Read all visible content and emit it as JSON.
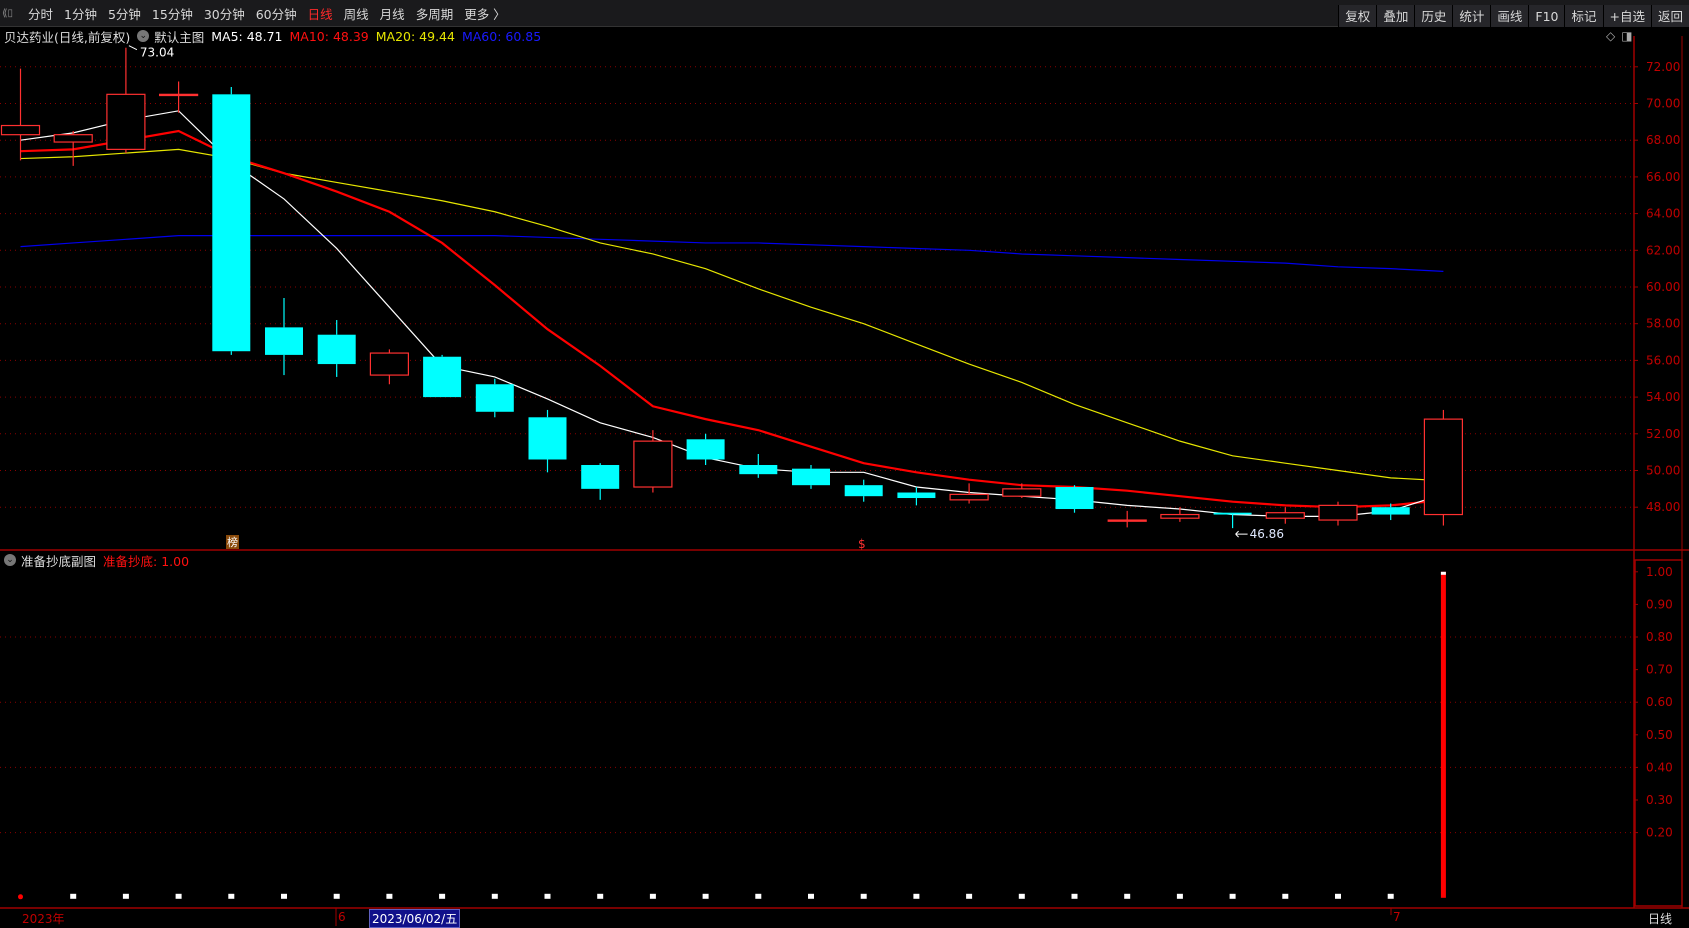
{
  "toolbar": {
    "periods": [
      "分时",
      "1分钟",
      "5分钟",
      "15分钟",
      "30分钟",
      "60分钟",
      "日线",
      "周线",
      "月线",
      "多周期",
      "更多 〉"
    ],
    "active_period": "日线",
    "actions": [
      "复权",
      "叠加",
      "历史",
      "统计",
      "画线",
      "F10",
      "标记",
      "+自选",
      "返回"
    ]
  },
  "main_header": {
    "stock": "贝达药业(日线,前复权)",
    "chart_name": "默认主图",
    "ma5": "MA5: 48.71",
    "ma10": "MA10: 48.39",
    "ma20": "MA20: 49.44",
    "ma60": "MA60: 60.85"
  },
  "sub_header": {
    "name": "准备抄底副图",
    "value": "准备抄底: 1.00"
  },
  "annotations": {
    "high_label": "73.04",
    "low_label": "46.86",
    "marker_bang": "榜",
    "marker_dollar": "$"
  },
  "datebar": {
    "year": "2023年",
    "month6": "6",
    "cursor_date": "2023/06/02/五",
    "month7": "7",
    "period_label": "日线"
  },
  "colors": {
    "up": "#ff3030",
    "down": "#00ffff",
    "ma5": "#ffffff",
    "ma10": "#ff0000",
    "ma20": "#e6e600",
    "ma60": "#0000ee",
    "axis": "#a00000"
  },
  "chart_data": {
    "type": "candlestick",
    "price_axis": {
      "min": 48,
      "max": 72,
      "step": 2,
      "ticks": [
        "72.00",
        "70.00",
        "68.00",
        "66.00",
        "64.00",
        "62.00",
        "60.00",
        "58.00",
        "56.00",
        "54.00",
        "52.00",
        "50.00",
        "48.00"
      ]
    },
    "candles": [
      [
        68.3,
        71.9,
        66.9,
        68.8
      ],
      [
        67.9,
        68.5,
        66.6,
        68.3
      ],
      [
        67.5,
        73.04,
        67.3,
        70.5
      ],
      [
        70.5,
        71.2,
        69.5,
        70.5
      ],
      [
        70.5,
        70.9,
        56.3,
        56.5
      ],
      [
        57.8,
        59.4,
        55.2,
        56.3
      ],
      [
        57.4,
        58.2,
        55.1,
        55.8
      ],
      [
        55.2,
        56.6,
        54.7,
        56.4
      ],
      [
        56.2,
        56.3,
        54.0,
        54.0
      ],
      [
        54.7,
        55.0,
        52.9,
        53.2
      ],
      [
        52.9,
        53.3,
        49.9,
        50.6
      ],
      [
        50.3,
        50.4,
        48.4,
        49.0
      ],
      [
        49.1,
        52.2,
        48.8,
        51.6
      ],
      [
        51.7,
        52.0,
        50.3,
        50.6
      ],
      [
        50.3,
        50.9,
        49.6,
        49.8
      ],
      [
        50.1,
        50.3,
        49.0,
        49.2
      ],
      [
        49.2,
        49.5,
        48.3,
        48.6
      ],
      [
        48.8,
        49.1,
        48.1,
        48.5
      ],
      [
        48.4,
        49.3,
        48.2,
        48.7
      ],
      [
        48.6,
        49.3,
        48.5,
        49.0
      ],
      [
        49.1,
        49.2,
        47.7,
        47.9
      ],
      [
        47.3,
        47.8,
        46.9,
        47.3
      ],
      [
        47.4,
        48.0,
        47.2,
        47.6
      ],
      [
        47.7,
        47.7,
        46.86,
        47.6
      ],
      [
        47.4,
        48.0,
        47.1,
        47.7
      ],
      [
        47.3,
        48.3,
        47.0,
        48.1
      ],
      [
        48.0,
        48.2,
        47.3,
        47.6
      ],
      [
        47.6,
        53.3,
        47.0,
        52.8
      ]
    ],
    "ma5": [
      68.0,
      68.4,
      69.1,
      69.6,
      66.8,
      64.8,
      62.1,
      58.9,
      55.7,
      55.1,
      53.9,
      52.6,
      51.8,
      50.7,
      50.1,
      49.9,
      49.9,
      49.1,
      48.8,
      48.6,
      48.4,
      48.1,
      47.9,
      47.6,
      47.5,
      47.5,
      47.8,
      48.71
    ],
    "ma10": [
      67.4,
      67.5,
      68.0,
      68.5,
      67.1,
      66.2,
      65.2,
      64.1,
      62.4,
      60.1,
      57.7,
      55.7,
      53.5,
      52.8,
      52.2,
      51.3,
      50.4,
      49.9,
      49.5,
      49.2,
      49.1,
      48.9,
      48.6,
      48.3,
      48.1,
      48.0,
      48.1,
      48.39
    ],
    "ma20": [
      67.0,
      67.1,
      67.3,
      67.5,
      67.0,
      66.2,
      65.7,
      65.2,
      64.7,
      64.1,
      63.3,
      62.4,
      61.8,
      61.0,
      59.9,
      58.9,
      58.0,
      56.9,
      55.8,
      54.8,
      53.6,
      52.6,
      51.6,
      50.8,
      50.4,
      50.0,
      49.6,
      49.44
    ],
    "ma60": [
      62.2,
      62.4,
      62.6,
      62.8,
      62.8,
      62.8,
      62.8,
      62.8,
      62.8,
      62.8,
      62.7,
      62.6,
      62.5,
      62.4,
      62.4,
      62.3,
      62.2,
      62.1,
      62.0,
      61.8,
      61.7,
      61.6,
      61.5,
      61.4,
      61.3,
      61.1,
      61.0,
      60.85
    ],
    "sub_axis": {
      "min": 0,
      "max": 1.0,
      "ticks": [
        "1.00",
        "0.90",
        "0.80",
        "0.70",
        "0.60",
        "0.50",
        "0.40",
        "0.30",
        "0.20"
      ]
    },
    "sub_values": [
      0,
      0,
      0,
      0,
      0,
      0,
      0,
      0,
      0,
      0,
      0,
      0,
      0,
      0,
      0,
      0,
      0,
      0,
      0,
      0,
      0,
      0,
      0,
      0,
      0,
      0,
      0,
      1.0
    ]
  }
}
